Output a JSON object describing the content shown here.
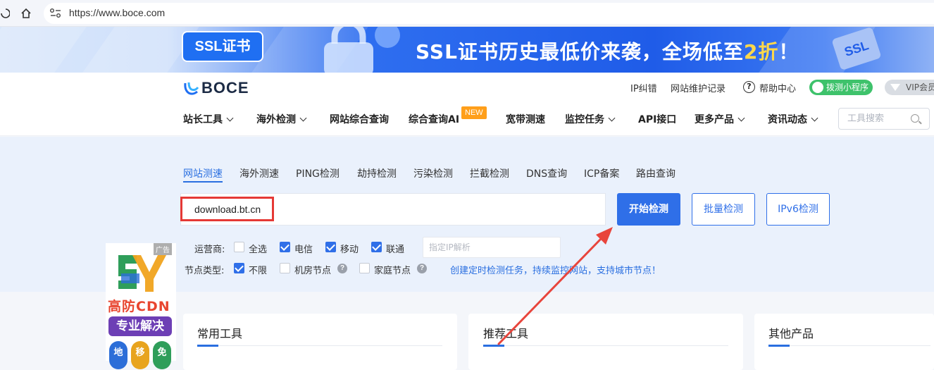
{
  "browser": {
    "url": "https://www.boce.com"
  },
  "banner": {
    "badge": "SSL证书",
    "headline_prefix": "SSL证书历史最低价来袭，全场低至",
    "headline_highlight": "2折",
    "headline_suffix": "！",
    "art_text": "SSL"
  },
  "header": {
    "logo": "BOCE",
    "links": {
      "ip_error": "IP纠错",
      "maintenance": "网站维护记录",
      "help": "帮助中心",
      "mini_program": "拨测小程序",
      "vip": "VIP会员"
    }
  },
  "nav": {
    "items": [
      "站长工具",
      "海外检测",
      "网站综合查询",
      "综合查询AI",
      "宽带测速",
      "监控任务",
      "API接口",
      "更多产品",
      "资讯动态"
    ],
    "new_badge": "NEW",
    "search_placeholder": "工具搜索"
  },
  "tabs": [
    "网站测速",
    "海外测速",
    "PING检测",
    "劫持检测",
    "污染检测",
    "拦截检测",
    "DNS查询",
    "ICP备案",
    "路由查询"
  ],
  "form": {
    "domain_value": "download.bt.cn",
    "start_button": "开始检测",
    "batch_button": "批量检测",
    "ipv6_button": "IPv6检测",
    "isp_label": "运营商:",
    "isp_options": [
      {
        "label": "全选",
        "checked": false
      },
      {
        "label": "电信",
        "checked": true
      },
      {
        "label": "移动",
        "checked": true
      },
      {
        "label": "联通",
        "checked": true
      }
    ],
    "ip_placeholder": "指定IP解析",
    "node_label": "节点类型:",
    "node_options": [
      {
        "label": "不限",
        "checked": true
      },
      {
        "label": "机房节点",
        "checked": false
      },
      {
        "label": "家庭节点",
        "checked": false
      }
    ],
    "promo": "创建定时检测任务，持续监控网站，支持城市节点！"
  },
  "ad": {
    "tag": "广告",
    "line1": "高防CDN",
    "line2": "专业解决",
    "pills": [
      "地",
      "移",
      "免"
    ]
  },
  "cards": [
    "常用工具",
    "推荐工具",
    "其他产品"
  ],
  "colors": {
    "accent": "#2f6fe8",
    "highlight_box": "#e53935",
    "arrow": "#e8453c"
  }
}
